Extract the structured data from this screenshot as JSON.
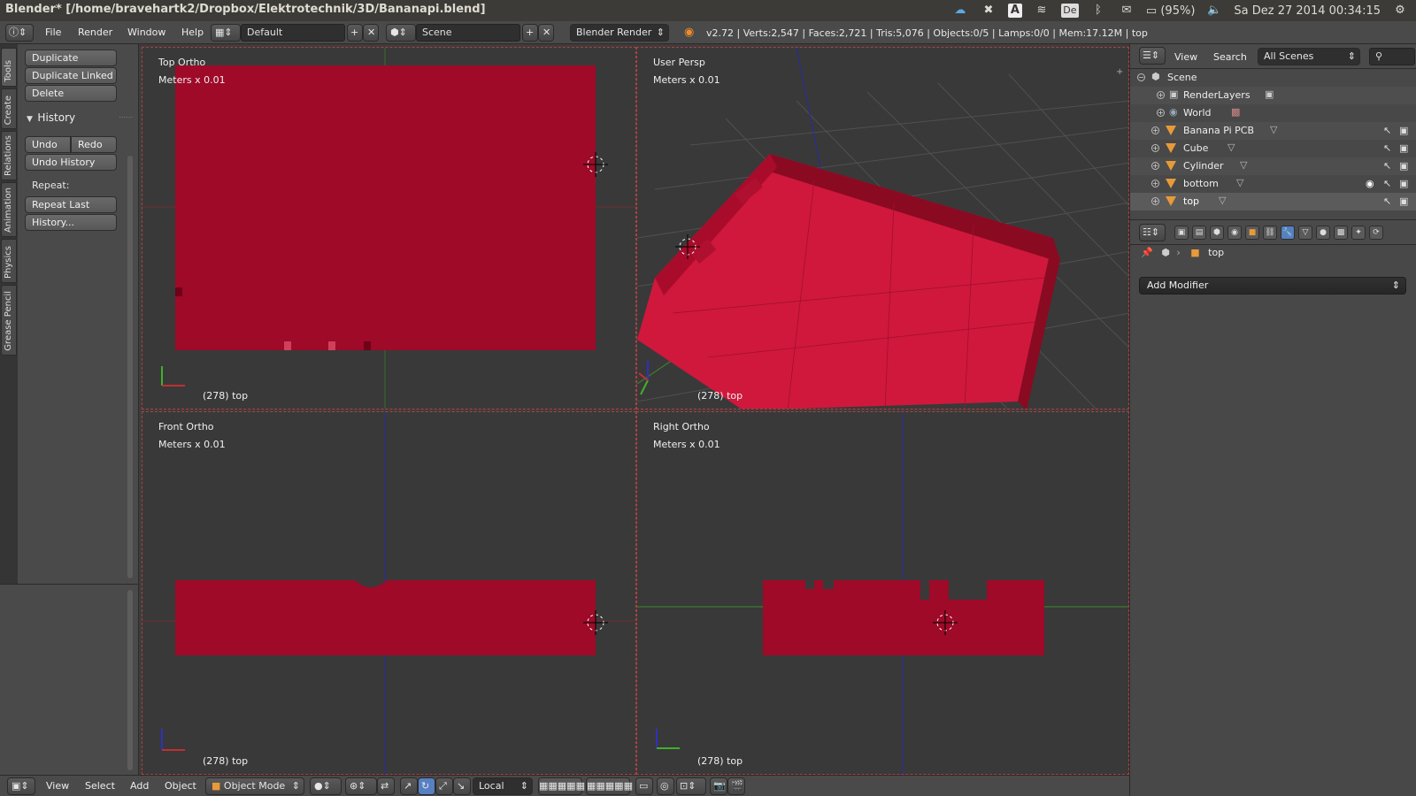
{
  "os": {
    "window_title": "Blender* [/home/bravehartk2/Dropbox/Elektrotechnik/3D/Bananapi.blend]",
    "keyboard_layout": "De",
    "battery": "(95%)",
    "datetime": "Sa Dez 27 2014 00:34:15"
  },
  "infobar": {
    "menus": [
      "File",
      "Render",
      "Window",
      "Help"
    ],
    "screen_layout": "Default",
    "scene": "Scene",
    "render_engine": "Blender Render",
    "stats": "v2.72 | Verts:2,547 | Faces:2,721 | Tris:5,076 | Objects:0/5 | Lamps:0/0 | Mem:17.12M | top"
  },
  "vtabs": [
    "Tools",
    "Create",
    "Relations",
    "Animation",
    "Physics",
    "Grease Pencil"
  ],
  "toolshelf": {
    "buttons_top": [
      "Duplicate",
      "Duplicate Linked",
      "Delete"
    ],
    "history_header": "History",
    "undo": "Undo",
    "redo": "Redo",
    "undo_history": "Undo History",
    "repeat_label": "Repeat:",
    "repeat_last": "Repeat Last",
    "history_btn": "History..."
  },
  "viewports": [
    {
      "label": "Top Ortho",
      "unit": "Meters x 0.01",
      "object": "(278) top"
    },
    {
      "label": "User Persp",
      "unit": "Meters x 0.01",
      "object": "(278) top"
    },
    {
      "label": "Front Ortho",
      "unit": "Meters x 0.01",
      "object": "(278) top"
    },
    {
      "label": "Right Ortho",
      "unit": "Meters x 0.01",
      "object": "(278) top"
    }
  ],
  "view3d_header": {
    "menus": [
      "View",
      "Select",
      "Add",
      "Object"
    ],
    "mode": "Object Mode",
    "orientation": "Local"
  },
  "outliner": {
    "menus": [
      "View",
      "Search"
    ],
    "filter": "All Scenes",
    "rows": [
      {
        "name": "Scene"
      },
      {
        "name": "RenderLayers"
      },
      {
        "name": "World"
      },
      {
        "name": "Banana Pi PCB"
      },
      {
        "name": "Cube"
      },
      {
        "name": "Cylinder"
      },
      {
        "name": "bottom"
      },
      {
        "name": "top"
      }
    ]
  },
  "properties": {
    "context_object": "top",
    "add_modifier": "Add Modifier"
  },
  "colors": {
    "mesh_red": "#9e0a28",
    "mesh_red_persp": "#d0183c",
    "viewport_bg": "#393939",
    "axis_red": "#8a2f2f",
    "axis_green": "#3f7a2a",
    "axis_blue": "#2a2a9a"
  }
}
